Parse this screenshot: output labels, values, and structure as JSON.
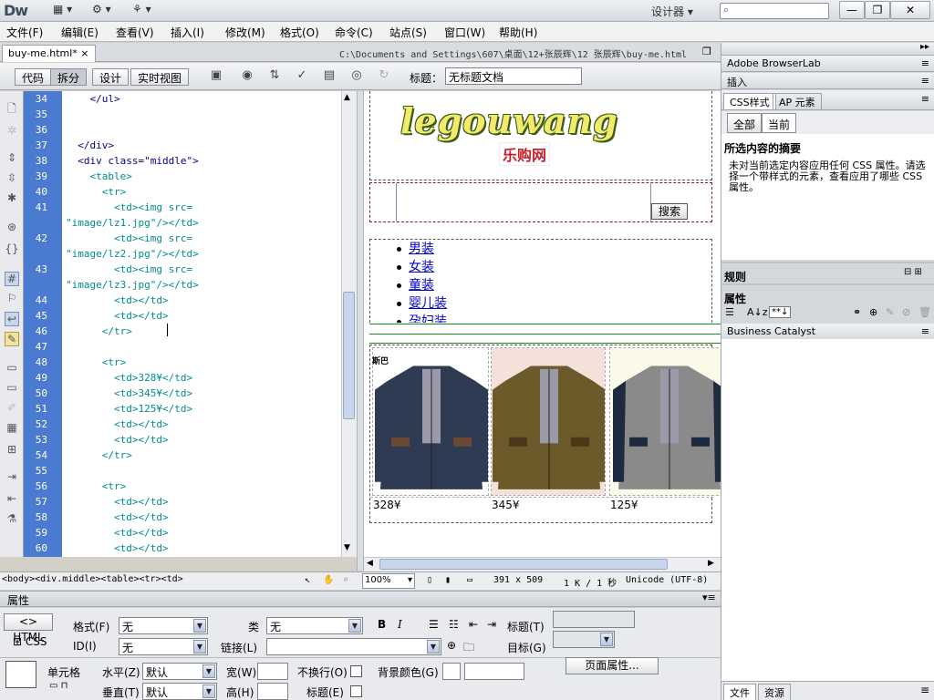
{
  "app": {
    "logo": "Dw",
    "workspace": "设计器",
    "topbar_icons": [
      "layout-icon",
      "gear-icon",
      "site-icon"
    ]
  },
  "window_controls": {
    "minimize": "—",
    "restore": "❐",
    "close": "✕"
  },
  "menu": [
    "文件(F)",
    "编辑(E)",
    "查看(V)",
    "插入(I)",
    "修改(M)",
    "格式(O)",
    "命令(C)",
    "站点(S)",
    "窗口(W)",
    "帮助(H)"
  ],
  "document": {
    "tab_name": "buy-me.html*",
    "path": "C:\\Documents and Settings\\607\\桌面\\12+张辰辉\\12 张辰辉\\buy-me.html",
    "views": [
      "代码",
      "拆分",
      "设计",
      "实时视图"
    ],
    "active_view": "拆分",
    "title_label": "标题：",
    "title_value": "无标题文档"
  },
  "code_lines": [
    {
      "n": "34",
      "code": "    </ul>"
    },
    {
      "n": "35",
      "code": ""
    },
    {
      "n": "36",
      "code": ""
    },
    {
      "n": "37",
      "code": "  </div>"
    },
    {
      "n": "38",
      "code": "  <div class=\"middle\">"
    },
    {
      "n": "39",
      "code": "    <table>"
    },
    {
      "n": "40",
      "code": "      <tr>"
    },
    {
      "n": "41",
      "code": "        <td><img src="
    },
    {
      "n": "",
      "code": "\"image/lz1.jpg\"/></td>"
    },
    {
      "n": "42",
      "code": "        <td><img src="
    },
    {
      "n": "",
      "code": "\"image/lz2.jpg\"/></td>"
    },
    {
      "n": "43",
      "code": "        <td><img src="
    },
    {
      "n": "",
      "code": "\"image/lz3.jpg\"/></td>"
    },
    {
      "n": "44",
      "code": "        <td></td>"
    },
    {
      "n": "45",
      "code": "        <td></td>"
    },
    {
      "n": "46",
      "code": "      </tr>"
    },
    {
      "n": "47",
      "code": ""
    },
    {
      "n": "48",
      "code": "      <tr>"
    },
    {
      "n": "49",
      "code": "        <td>328¥</td>"
    },
    {
      "n": "50",
      "code": "        <td>345¥</td>"
    },
    {
      "n": "51",
      "code": "        <td>125¥</td>"
    },
    {
      "n": "52",
      "code": "        <td></td>"
    },
    {
      "n": "53",
      "code": "        <td></td>"
    },
    {
      "n": "54",
      "code": "      </tr>"
    },
    {
      "n": "55",
      "code": ""
    },
    {
      "n": "56",
      "code": "      <tr>"
    },
    {
      "n": "57",
      "code": "        <td></td>"
    },
    {
      "n": "58",
      "code": "        <td></td>"
    },
    {
      "n": "59",
      "code": "        <td></td>"
    },
    {
      "n": "60",
      "code": "        <td></td>"
    }
  ],
  "design": {
    "brand": "legouwang",
    "brand_sub": "乐购网",
    "search_button": "搜索",
    "categories": [
      "男装",
      "女装",
      "童装",
      "婴儿装",
      "孕妇装"
    ],
    "product_label": "斯巴",
    "products": [
      {
        "price": "328¥",
        "colors": [
          "#2e3b52",
          "#6a4a32"
        ]
      },
      {
        "price": "345¥",
        "colors": [
          "#6d5a2a",
          "#4a3a1a"
        ]
      },
      {
        "price": "125¥",
        "colors": [
          "#8a8a8a",
          "#1e2a40"
        ]
      }
    ]
  },
  "status": {
    "tag_selector": "<body><div.middle><table><tr><td>",
    "zoom": "100%",
    "dimensions": "391 x 509",
    "size": "1 K / 1 秒",
    "encoding": "Unicode (UTF-8)"
  },
  "properties": {
    "header": "属性",
    "html_btn": "HTML",
    "css_btn": "CSS",
    "format_label": "格式(F)",
    "format_value": "无",
    "class_label": "类",
    "class_value": "无",
    "id_label": "ID(I)",
    "id_value": "无",
    "link_label": "链接(L)",
    "title_label": "标题(T)",
    "target_label": "目标(G)",
    "cell_label": "单元格",
    "halign_label": "水平(Z)",
    "halign_value": "默认",
    "valign_label": "垂直(T)",
    "valign_value": "默认",
    "width_label": "宽(W)",
    "height_label": "高(H)",
    "nowrap_label": "不换行(O)",
    "header_label": "标题(E)",
    "bgcolor_label": "背景颜色(G)",
    "page_props_btn": "页面属性..."
  },
  "right_panel": {
    "browserlab": "Adobe BrowserLab",
    "insert": "插入",
    "tab_css": "CSS样式",
    "tab_ap": "AP 元素",
    "seg_all": "全部",
    "seg_current": "当前",
    "summary_title": "所选内容的摘要",
    "summary_text": "未对当前选定内容应用任何 CSS 属性。请选择一个带样式的元素，查看应用了哪些 CSS 属性。",
    "rules_title": "规则",
    "props_title": "属性",
    "business_catalyst": "Business Catalyst",
    "bottom_tab_files": "文件",
    "bottom_tab_assets": "资源"
  }
}
